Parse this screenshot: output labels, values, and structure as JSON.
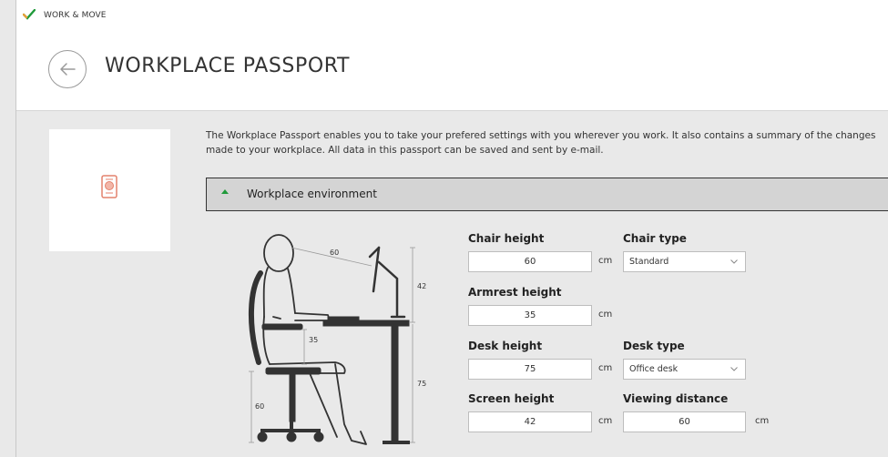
{
  "app": {
    "name": "WORK & MOVE"
  },
  "header": {
    "title": "WORKPLACE PASSPORT"
  },
  "intro": "The Workplace Passport enables you to take your prefered settings with you wherever you work. It also contains a summary of the changes made to your workplace. All data in this passport can be saved and sent by e-mail.",
  "section": {
    "label": "Workplace environment"
  },
  "figure": {
    "viewing_distance": "60",
    "screen_height": "42",
    "armrest_height": "35",
    "desk_height": "75",
    "chair_height": "60"
  },
  "form": {
    "chair_height": {
      "label": "Chair height",
      "value": "60",
      "unit": "cm"
    },
    "chair_type": {
      "label": "Chair type",
      "value": "Standard"
    },
    "armrest_height": {
      "label": "Armrest height",
      "value": "35",
      "unit": "cm"
    },
    "desk_height": {
      "label": "Desk height",
      "value": "75",
      "unit": "cm"
    },
    "desk_type": {
      "label": "Desk type",
      "value": "Office desk"
    },
    "screen_height": {
      "label": "Screen height",
      "value": "42",
      "unit": "cm"
    },
    "viewing_distance": {
      "label": "Viewing distance",
      "value": "60",
      "unit": "cm"
    }
  },
  "colors": {
    "accent_green": "#1f9a3a",
    "passport_icon": "#e4826d"
  }
}
